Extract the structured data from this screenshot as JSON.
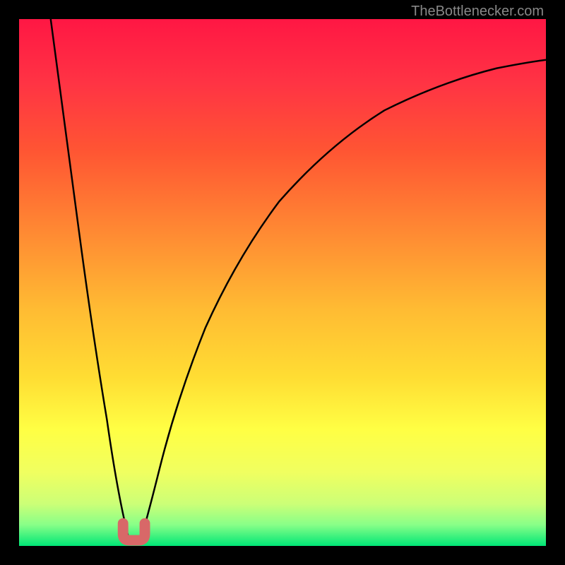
{
  "attribution": "TheBottlenecker.com",
  "chart_data": {
    "type": "line",
    "title": "",
    "xlabel": "",
    "ylabel": "",
    "xlim": [
      0,
      100
    ],
    "ylim": [
      0,
      100
    ],
    "curve_left": {
      "description": "Left descending branch of bottleneck curve",
      "x": [
        6,
        8,
        10,
        12,
        14,
        16,
        17,
        18,
        19,
        20
      ],
      "y": [
        100,
        86,
        70,
        55,
        40,
        25,
        15,
        8,
        3,
        0
      ]
    },
    "curve_right": {
      "description": "Right ascending branch of bottleneck curve",
      "x": [
        22,
        24,
        26,
        30,
        35,
        40,
        50,
        60,
        70,
        80,
        90,
        100
      ],
      "y": [
        0,
        8,
        18,
        35,
        50,
        60,
        72,
        79,
        84,
        87,
        89,
        91
      ]
    },
    "minimum_marker": {
      "x": 21,
      "y": 0,
      "color": "#d86868"
    },
    "background_gradient": {
      "type": "vertical",
      "stops": [
        {
          "offset": 0,
          "color": "#ff1744"
        },
        {
          "offset": 25,
          "color": "#ff5533"
        },
        {
          "offset": 50,
          "color": "#ffaa22"
        },
        {
          "offset": 70,
          "color": "#ffee33"
        },
        {
          "offset": 85,
          "color": "#eeff55"
        },
        {
          "offset": 94,
          "color": "#aaff77"
        },
        {
          "offset": 100,
          "color": "#00e676"
        }
      ]
    }
  }
}
